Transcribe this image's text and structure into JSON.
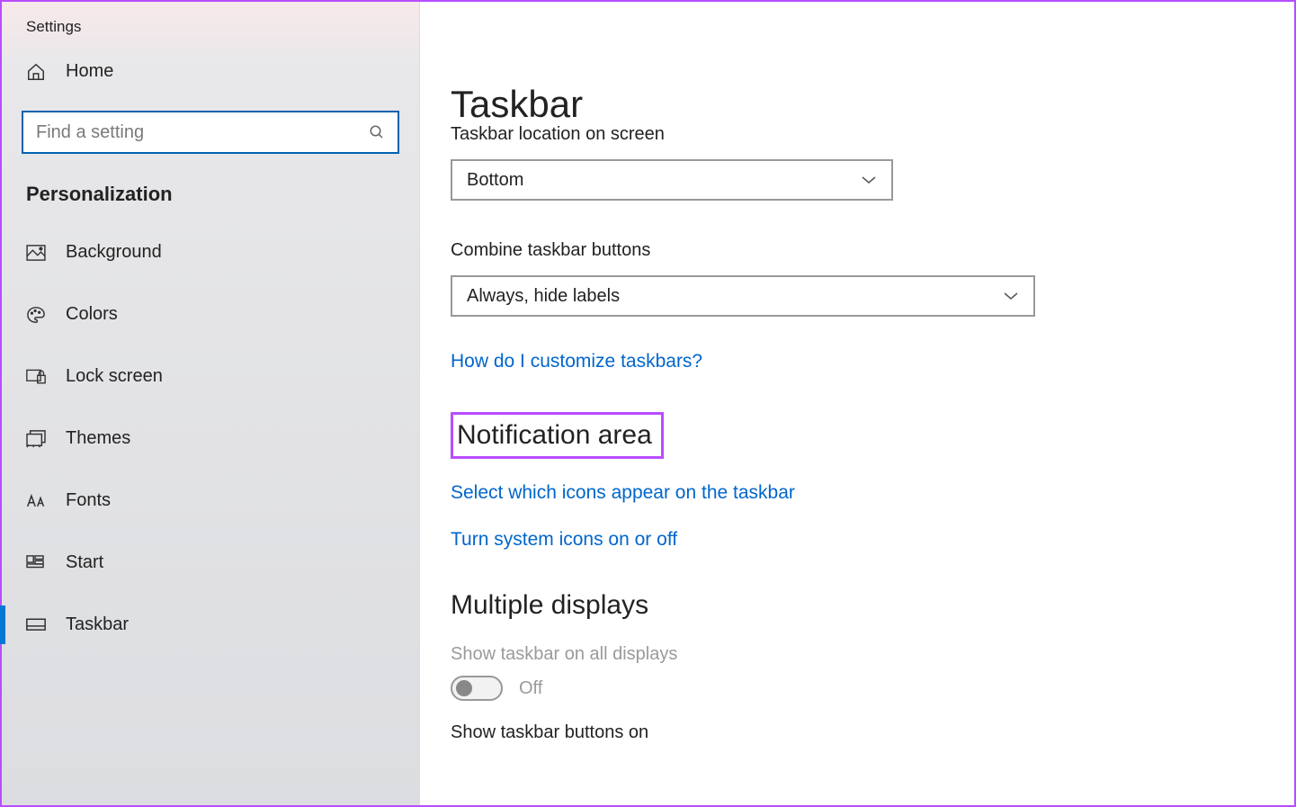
{
  "app": {
    "title": "Settings"
  },
  "sidebar": {
    "home_label": "Home",
    "search_placeholder": "Find a setting",
    "section": "Personalization",
    "items": [
      {
        "label": "Background",
        "icon": "image-icon"
      },
      {
        "label": "Colors",
        "icon": "palette-icon"
      },
      {
        "label": "Lock screen",
        "icon": "lockscreen-icon"
      },
      {
        "label": "Themes",
        "icon": "themes-icon"
      },
      {
        "label": "Fonts",
        "icon": "fonts-icon"
      },
      {
        "label": "Start",
        "icon": "start-icon"
      },
      {
        "label": "Taskbar",
        "icon": "taskbar-icon"
      }
    ]
  },
  "main": {
    "title": "Taskbar",
    "location_label": "Taskbar location on screen",
    "location_value": "Bottom",
    "combine_label": "Combine taskbar buttons",
    "combine_value": "Always, hide labels",
    "help_link": "How do I customize taskbars?",
    "notification_heading": "Notification area",
    "notif_link1": "Select which icons appear on the taskbar",
    "notif_link2": "Turn system icons on or off",
    "multi_heading": "Multiple displays",
    "multi_toggle_label": "Show taskbar on all displays",
    "multi_toggle_state": "Off",
    "multi_buttons_label": "Show taskbar buttons on"
  }
}
